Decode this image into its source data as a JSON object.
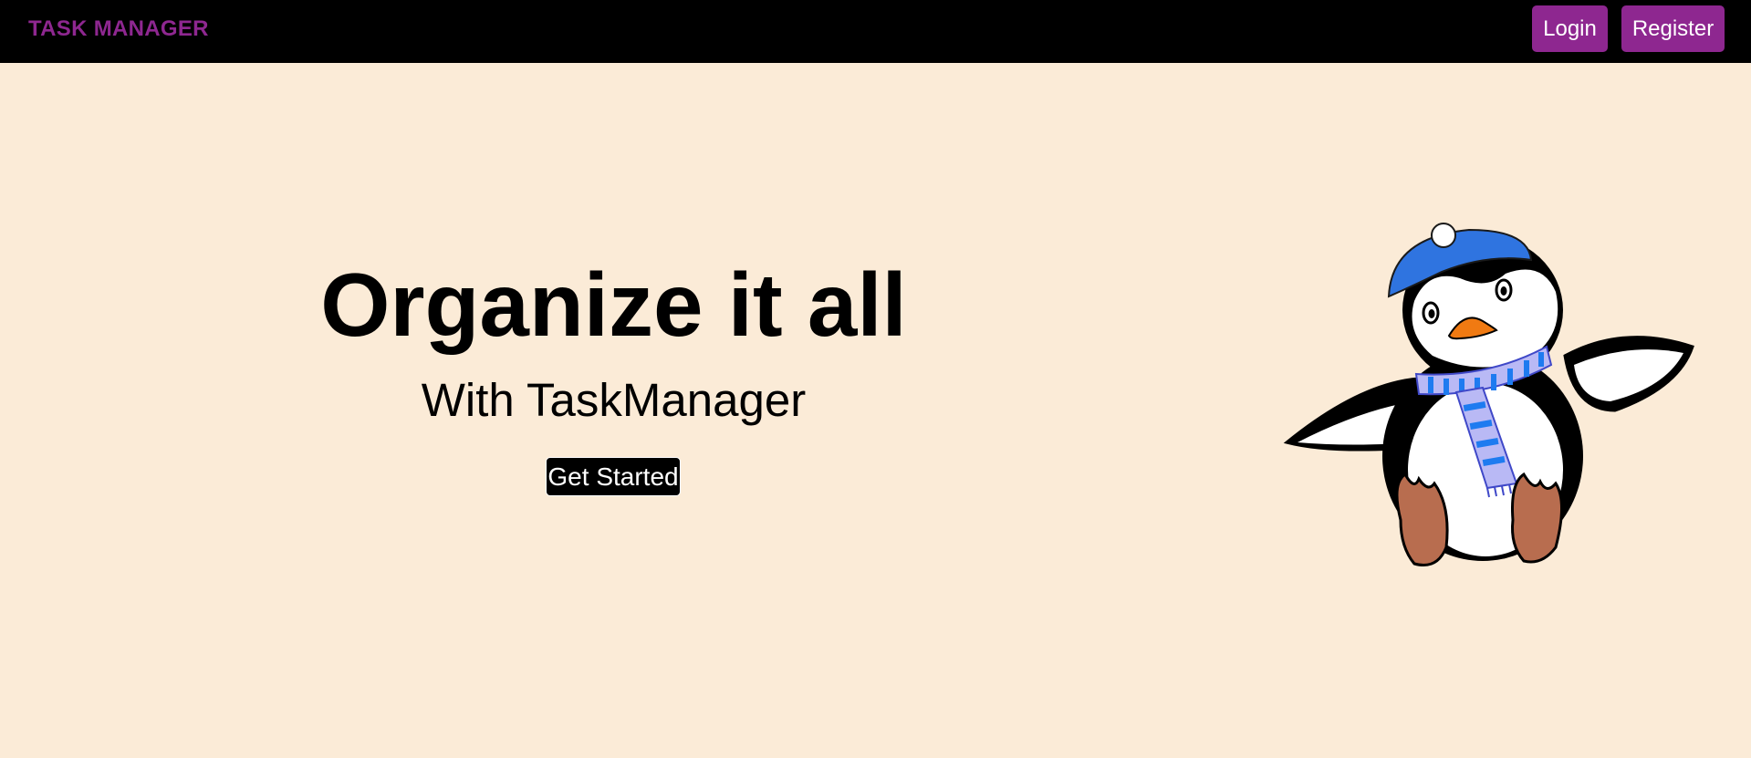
{
  "navbar": {
    "brand": "TASK MANAGER",
    "login_label": "Login",
    "register_label": "Register"
  },
  "hero": {
    "title": "Organize it all",
    "subtitle": "With TaskManager",
    "cta_label": "Get Started"
  },
  "illustration": {
    "icon": "penguin-mascot-icon"
  },
  "colors": {
    "background": "#fbebd7",
    "navbar": "#000000",
    "accent": "#8e2790",
    "hat": "#2f74e0",
    "scarf_light": "#b9b9f5",
    "scarf_stripe": "#1e7bf0",
    "beak": "#f07a12",
    "feet": "#b86d4f"
  }
}
